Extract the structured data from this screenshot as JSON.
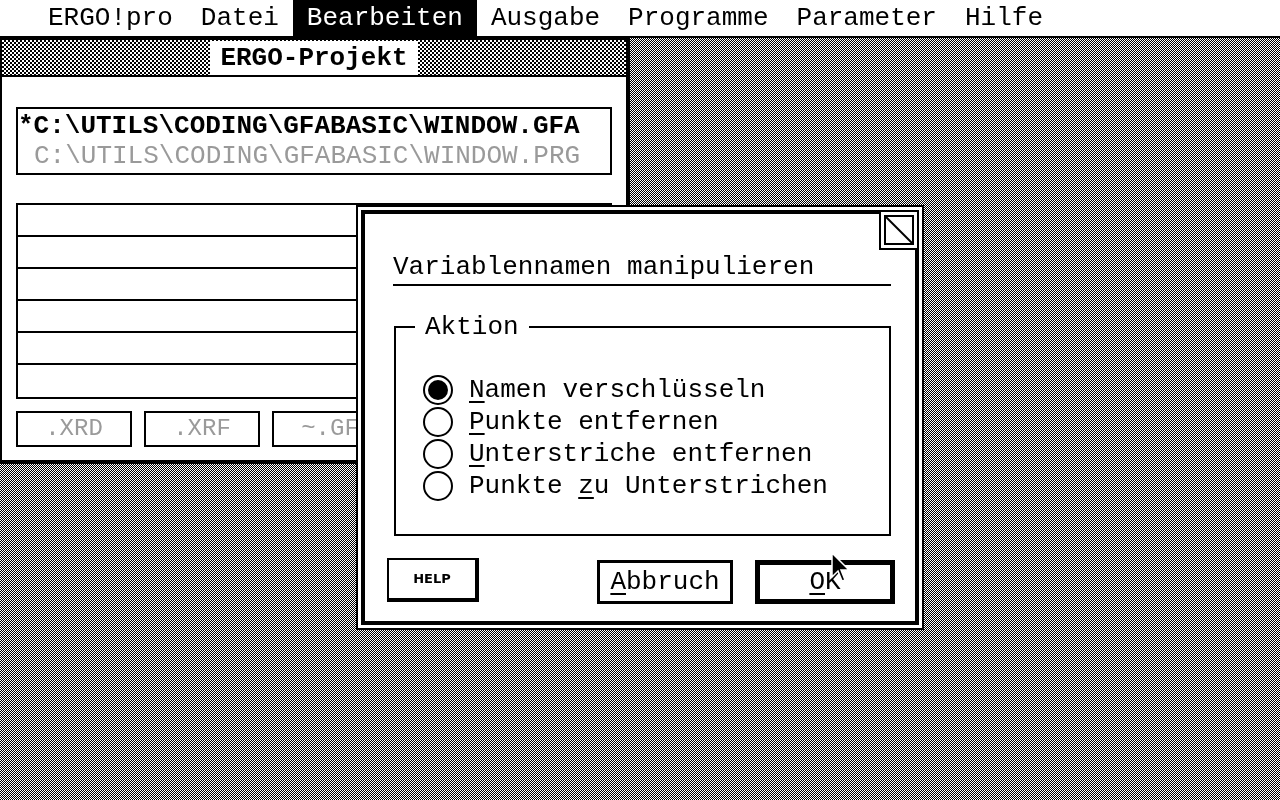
{
  "menu_bar": [
    {
      "label": "ERGO!pro",
      "selected": false
    },
    {
      "label": "Datei",
      "selected": false
    },
    {
      "label": "Bearbeiten",
      "selected": true
    },
    {
      "label": "Ausgabe",
      "selected": false
    },
    {
      "label": "Programme",
      "selected": false
    },
    {
      "label": "Parameter",
      "selected": false
    },
    {
      "label": "Hilfe",
      "selected": false
    }
  ],
  "project_window": {
    "title": "ERGO-Projekt",
    "files": [
      {
        "path": "*C:\\UTILS\\CODING\\GFABASIC\\WINDOW.GFA",
        "disabled": false
      },
      {
        "path": "C:\\UTILS\\CODING\\GFABASIC\\WINDOW.PRG",
        "disabled": true
      }
    ],
    "buttons": [
      {
        "label": ".XRD",
        "disabled": true
      },
      {
        "label": ".XRF",
        "disabled": true
      },
      {
        "label": "~.GF",
        "disabled": true
      }
    ]
  },
  "dialog": {
    "title": "Variablennamen manipulieren",
    "group_label": "Aktion",
    "options": [
      {
        "hotkey": "N",
        "label_after": "amen verschlüsseln",
        "selected": true
      },
      {
        "hotkey": "P",
        "label_after": "unkte entfernen",
        "selected": false
      },
      {
        "hotkey": "U",
        "label_after": "nterstriche entfernen",
        "selected": false
      },
      {
        "label_before": "Punkte ",
        "hotkey": "z",
        "label_after": "u Unterstrichen",
        "selected": false
      }
    ],
    "help_button": "HELP",
    "buttons": [
      {
        "hotkey": "A",
        "label_after": "bbruch",
        "default": false
      },
      {
        "hotkey": "O",
        "label_after": "K",
        "default": true
      }
    ]
  }
}
